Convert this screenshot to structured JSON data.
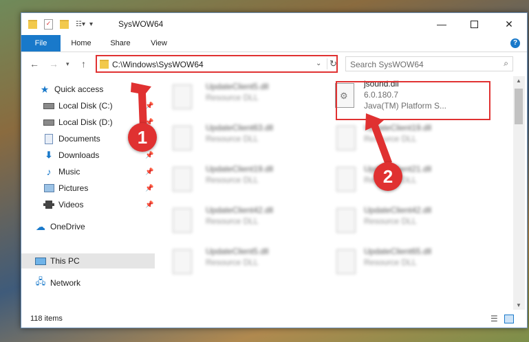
{
  "window": {
    "title": "SysWOW64"
  },
  "ribbon": {
    "tabs": [
      "File",
      "Home",
      "Share",
      "View"
    ],
    "help_label": "?"
  },
  "navigation": {
    "address_path": "C:\\Windows\\SysWOW64",
    "search_placeholder": "Search SysWOW64"
  },
  "sidebar": {
    "items": [
      {
        "label": "Quick access",
        "icon": "star-icon"
      },
      {
        "label": "Local Disk (C:)",
        "icon": "drive-icon",
        "pinned": true
      },
      {
        "label": "Local Disk (D:)",
        "icon": "drive-icon",
        "pinned": true
      },
      {
        "label": "Documents",
        "icon": "documents-icon",
        "pinned": true
      },
      {
        "label": "Downloads",
        "icon": "downloads-icon",
        "pinned": true
      },
      {
        "label": "Music",
        "icon": "music-icon",
        "pinned": true
      },
      {
        "label": "Pictures",
        "icon": "pictures-icon",
        "pinned": true
      },
      {
        "label": "Videos",
        "icon": "videos-icon",
        "pinned": true
      },
      {
        "label": "OneDrive",
        "icon": "onedrive-icon"
      },
      {
        "label": "This PC",
        "icon": "computer-icon",
        "selected": true
      },
      {
        "label": "Network",
        "icon": "network-icon"
      }
    ]
  },
  "files": {
    "left_column": [
      {
        "name": "UpdateClient5.dll",
        "type": "Resource DLL"
      },
      {
        "name": "UpdateClient63.dll",
        "type": "Resource DLL"
      },
      {
        "name": "UpdateClient19.dll",
        "type": "Resource DLL"
      },
      {
        "name": "UpdateClient42.dll",
        "type": "Resource DLL"
      },
      {
        "name": "UpdateClient5.dll",
        "type": "Resource DLL"
      }
    ],
    "right_column": [
      {
        "name": "jsound.dll",
        "version": "6.0.180.7",
        "type": "Java(TM) Platform S..."
      },
      {
        "name": "UpdateClient19.dll",
        "type": "Resource DLL"
      },
      {
        "name": "UpdateClient21.dll",
        "type": "Resource DLL"
      },
      {
        "name": "UpdateClient42.dll",
        "type": "Resource DLL"
      },
      {
        "name": "UpdateClient65.dll",
        "type": "Resource DLL"
      }
    ]
  },
  "status": {
    "item_count": "118 items"
  },
  "annotations": {
    "step1": "1",
    "step2": "2",
    "accent_color": "#e03131"
  }
}
